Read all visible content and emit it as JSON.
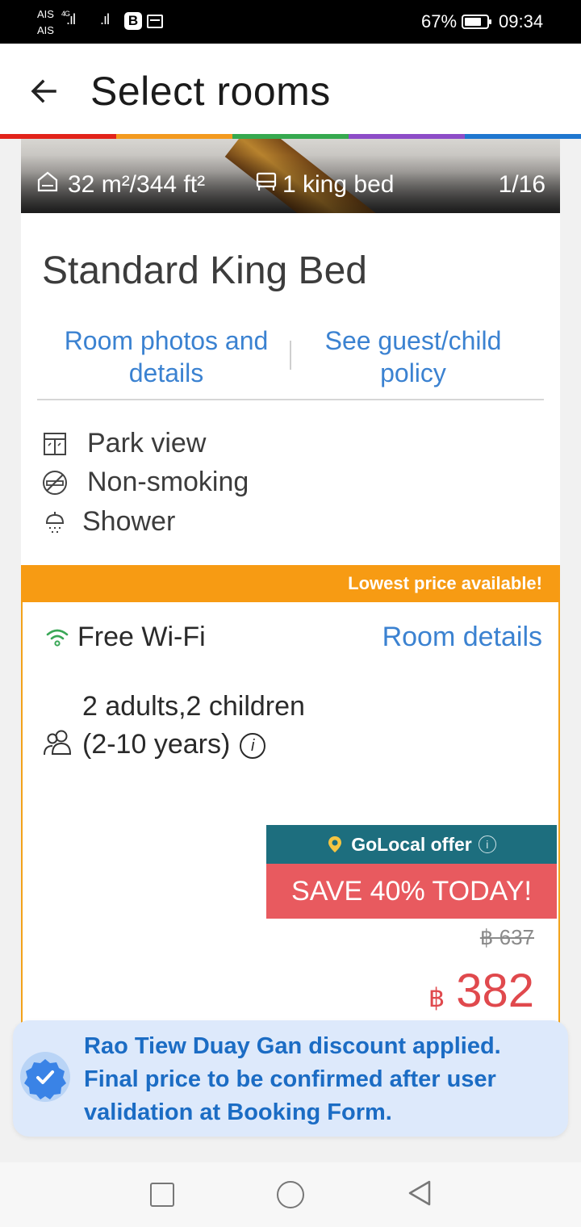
{
  "status_bar": {
    "carrier1": "AIS",
    "carrier2": "AIS",
    "network": "4G",
    "b_badge": "B",
    "battery": "67%",
    "time": "09:34"
  },
  "header": {
    "title": "Select rooms"
  },
  "rainbow_colors": [
    "#e2231a",
    "#f39a1f",
    "#36a94f",
    "#8d4dc7",
    "#1f77d0"
  ],
  "photo": {
    "size": "32 m²/344 ft²",
    "bed": "1 king bed",
    "counter": "1/16"
  },
  "room": {
    "name": "Standard King Bed",
    "link_photos": "Room photos and details",
    "link_policy": "See guest/child policy",
    "features": [
      {
        "icon": "window-view-icon",
        "label": "Park view"
      },
      {
        "icon": "no-smoking-icon",
        "label": "Non-smoking"
      },
      {
        "icon": "shower-icon",
        "label": "Shower"
      }
    ]
  },
  "offer": {
    "banner": "Lowest price available!",
    "wifi": "Free Wi-Fi",
    "room_details": "Room details",
    "occupancy": "2 adults,2 children (2-10 years)",
    "info_symbol": "i",
    "golocal": "GoLocal offer",
    "save": "SAVE 40% TODAY!",
    "old_price": "฿ 637",
    "currency": "฿",
    "new_price": "382"
  },
  "toast": {
    "message": "Rao Tiew Duay Gan discount applied. Final price to be confirmed after user validation at Booking Form."
  },
  "colors": {
    "link_blue": "#3b82d1",
    "banner_orange": "#f79b13",
    "golocal_teal": "#1d6e7e",
    "save_red": "#e85a5f",
    "price_red": "#e0494d"
  }
}
